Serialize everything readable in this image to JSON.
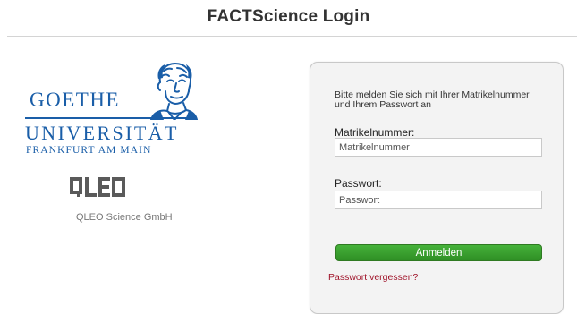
{
  "header": {
    "title": "FACTScience Login"
  },
  "logos": {
    "goethe": {
      "word": "GOETHE",
      "university": "UNIVERSITÄT",
      "city": "FRANKFURT AM MAIN",
      "color": "#1a5ea8",
      "icon": "goethe-portrait-icon"
    },
    "qleo": {
      "wordmark": "QLEO",
      "caption": "QLEO Science GmbH",
      "color": "#5a5a5a"
    }
  },
  "login": {
    "intro": "Bitte melden Sie sich mit Ihrer Matrikelnummer und Ihrem Passwort an",
    "username_label": "Matrikelnummer:",
    "username_placeholder": "Matrikelnummer",
    "password_label": "Passwort:",
    "password_placeholder": "Passwort",
    "submit_label": "Anmelden",
    "forgot_label": "Passwort vergessen?",
    "button_color": "#3a9f2e",
    "link_color": "#a0142a"
  }
}
